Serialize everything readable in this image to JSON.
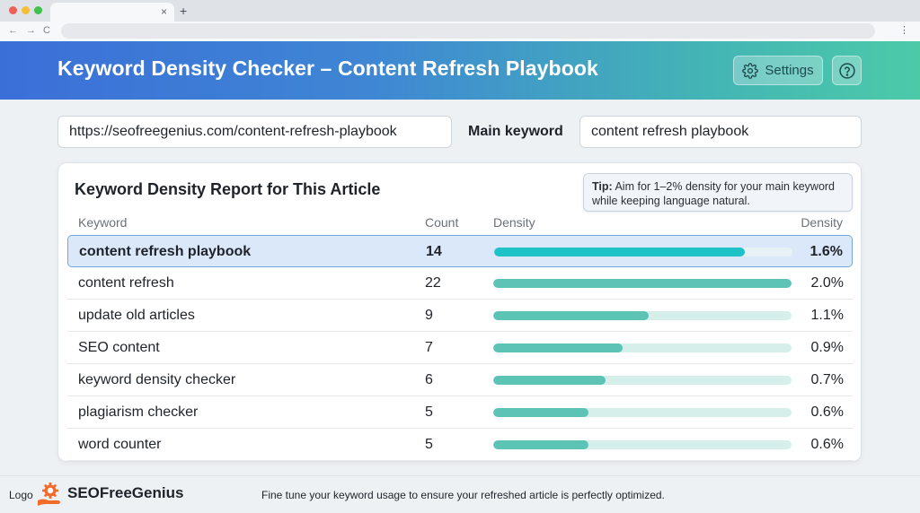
{
  "browser": {
    "tab_close": "×",
    "new_tab": "+",
    "nav_back": "←",
    "nav_forward": "→",
    "nav_reload": "C",
    "menu": "⋮"
  },
  "header": {
    "title": "Keyword Density Checker – Content Refresh Playbook",
    "settings_label": "Settings"
  },
  "inputs": {
    "url_value": "https://seofreegenius.com/content-refresh-playbook",
    "main_keyword_label": "Main keyword",
    "main_keyword_value": "content refresh playbook"
  },
  "report": {
    "title": "Keyword Density Report for This Article",
    "tip_bold": "Tip:",
    "tip_text": " Aim for 1–2% density for your main keyword while keeping language natural.",
    "columns": {
      "keyword": "Keyword",
      "count": "Count",
      "density_bar": "Density",
      "density_value": "Density"
    },
    "rows": [
      {
        "keyword": "content refresh playbook",
        "count": "14",
        "density": "1.6%",
        "fill": 0.84,
        "highlighted": true
      },
      {
        "keyword": "content refresh",
        "count": "22",
        "density": "2.0%",
        "fill": 1.0,
        "highlighted": false
      },
      {
        "keyword": "update old articles",
        "count": "9",
        "density": "1.1%",
        "fill": 0.52,
        "highlighted": false
      },
      {
        "keyword": "SEO content",
        "count": "7",
        "density": "0.9%",
        "fill": 0.435,
        "highlighted": false
      },
      {
        "keyword": "keyword density checker",
        "count": "6",
        "density": "0.7%",
        "fill": 0.375,
        "highlighted": false
      },
      {
        "keyword": "plagiarism checker",
        "count": "5",
        "density": "0.6%",
        "fill": 0.32,
        "highlighted": false
      },
      {
        "keyword": "word counter",
        "count": "5",
        "density": "0.6%",
        "fill": 0.32,
        "highlighted": false
      }
    ]
  },
  "footer": {
    "logo_label": "Logo",
    "brand": "SEOFreeGenius",
    "message": "Fine tune your keyword usage to ensure your refreshed article is perfectly optimized."
  },
  "colors": {
    "header_gradient_start": "#3b6fd8",
    "header_gradient_end": "#4ccaa8",
    "bar_fill": "#5cc3b6",
    "bar_fill_highlight": "#1fc3c7",
    "bar_track": "#d6efea",
    "logo_orange": "#f26b2b"
  },
  "icons": {
    "settings": "gear-icon",
    "help": "question-circle-icon",
    "logo": "brain-gear-logo-icon"
  }
}
